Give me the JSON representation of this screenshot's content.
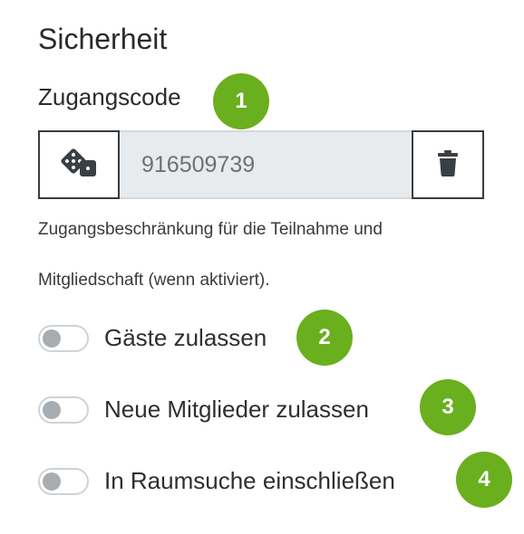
{
  "security": {
    "title": "Sicherheit",
    "access_code_label": "Zugangscode",
    "access_code_value": "916509739",
    "help_text_line1": "Zugangsbeschränkung für die Teilnahme und",
    "help_text_line2": "Mitgliedschaft (wenn aktiviert).",
    "dice_icon": "dice-icon",
    "trash_icon": "trash-icon"
  },
  "toggles": [
    {
      "label": "Gäste zulassen",
      "enabled": false
    },
    {
      "label": "Neue Mitglieder zulassen",
      "enabled": false
    },
    {
      "label": "In Raumsuche einschließen",
      "enabled": false
    }
  ],
  "badges": [
    {
      "number": "1"
    },
    {
      "number": "2"
    },
    {
      "number": "3"
    },
    {
      "number": "4"
    }
  ],
  "colors": {
    "badge": "#6aaf1e",
    "field_background": "#e8ebee",
    "border": "#3b3b3b",
    "toggle_knob": "#a8adb2"
  }
}
